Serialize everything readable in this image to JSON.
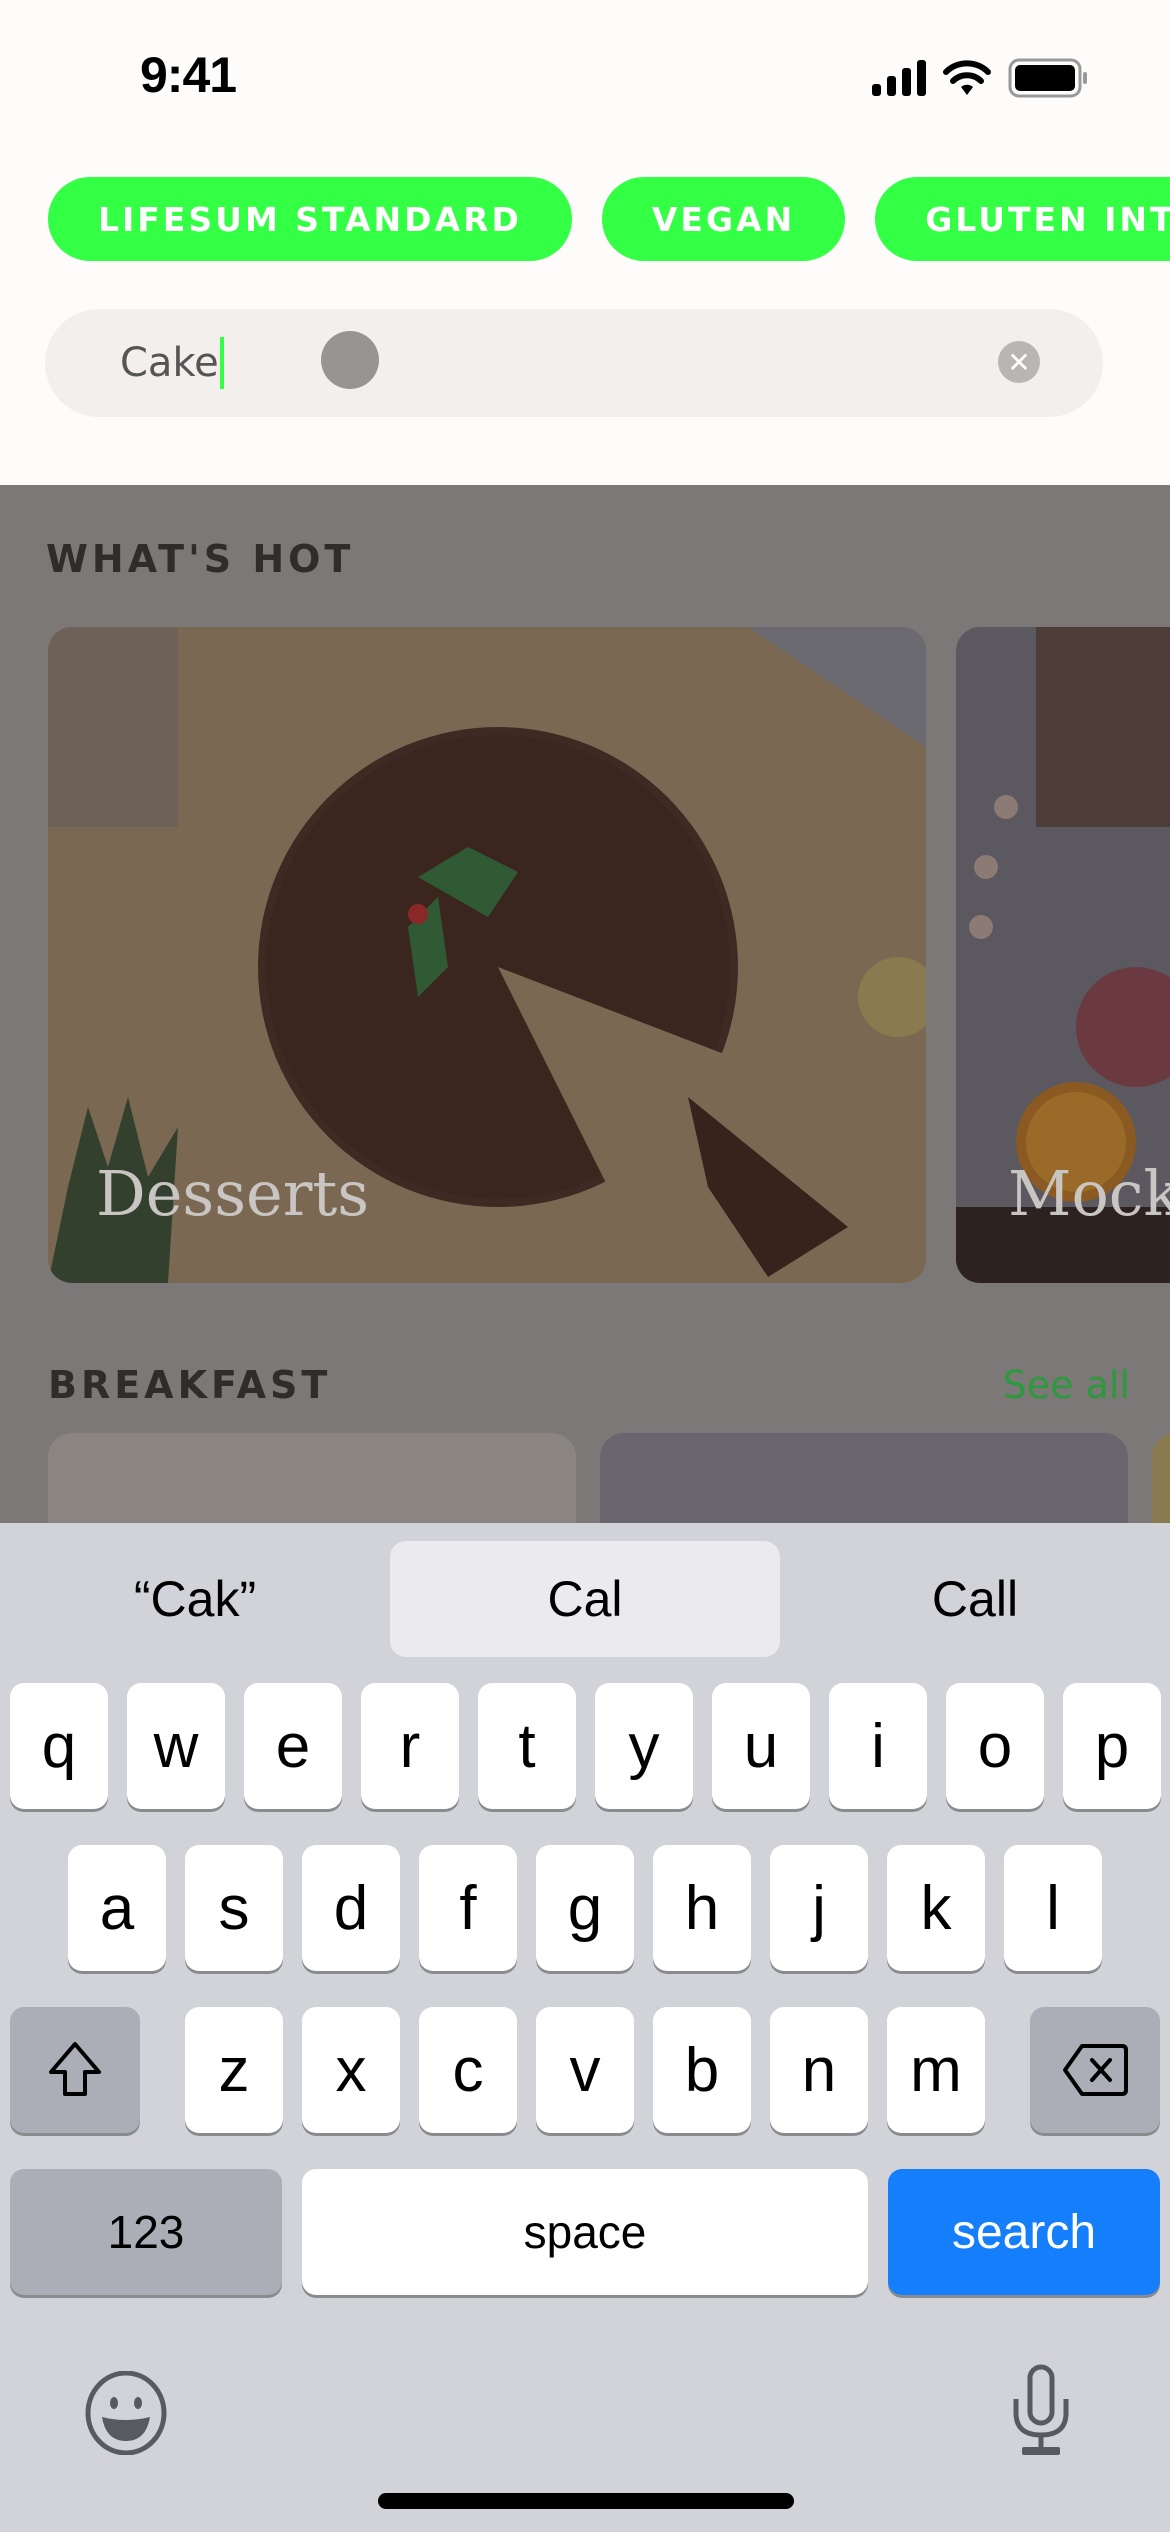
{
  "status_bar": {
    "time": "9:41",
    "icons": [
      "cellular-signal-icon",
      "wifi-icon",
      "battery-icon"
    ]
  },
  "filters": {
    "chips": [
      {
        "label": "LIFESUM STANDARD"
      },
      {
        "label": "VEGAN"
      },
      {
        "label": "GLUTEN INTO"
      }
    ],
    "chip_color": "#33ff44"
  },
  "search": {
    "value": "Cake",
    "clear_icon": "clear-icon"
  },
  "whats_hot": {
    "title": "WHAT'S HOT",
    "cards": [
      {
        "title": "Desserts"
      },
      {
        "title": "Mock"
      }
    ]
  },
  "breakfast": {
    "title": "BREAKFAST",
    "see_all": "See all",
    "see_all_color": "#2c9a3c"
  },
  "keyboard": {
    "suggestions": [
      "“Cak”",
      "Cal",
      "Call"
    ],
    "row1": [
      "q",
      "w",
      "e",
      "r",
      "t",
      "y",
      "u",
      "i",
      "o",
      "p"
    ],
    "row2": [
      "a",
      "s",
      "d",
      "f",
      "g",
      "h",
      "j",
      "k",
      "l"
    ],
    "row3": [
      "z",
      "x",
      "c",
      "v",
      "b",
      "n",
      "m"
    ],
    "numbers_label": "123",
    "space_label": "space",
    "search_label": "search",
    "search_color": "#157efb"
  }
}
